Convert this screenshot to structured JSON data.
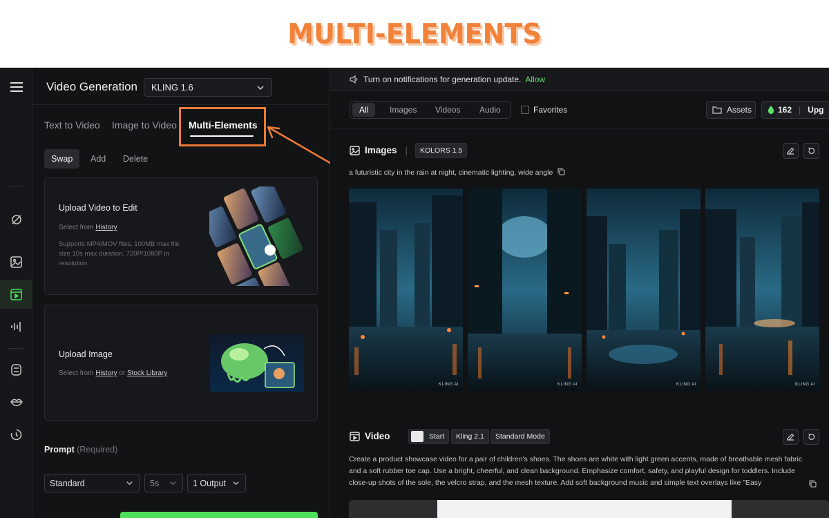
{
  "banner": {
    "title": "MULTI-ELEMENTS"
  },
  "rail": {
    "icons": [
      "menu-icon",
      "magic-brush-icon",
      "image-icon",
      "video-icon",
      "audio-icon",
      "avatar-frame-icon",
      "lips-icon",
      "history-icon"
    ]
  },
  "left": {
    "title": "Video Generation",
    "model": "KLING 1.6",
    "tabs": [
      "Text to Video",
      "Image to Video",
      "Multi-Elements"
    ],
    "actions": [
      "Swap",
      "Add",
      "Delete"
    ],
    "upload_video": {
      "title": "Upload Video to Edit",
      "select_prefix": "Select from ",
      "history_link": "History",
      "desc": "Supports MP4/MOV files, 100MB max file size 10s max duration, 720P/1080P in resolution"
    },
    "upload_image": {
      "title": "Upload Image",
      "select_prefix": "Select from ",
      "history_link": "History",
      "or": " or ",
      "stock_link": "Stock Library"
    },
    "prompt_label": "Prompt",
    "prompt_required": "(Required)",
    "mode_select": "Standard",
    "duration_select": "5s",
    "output_select": "1 Output"
  },
  "right": {
    "notification": "Turn on notifications for generation update.",
    "allow": "Allow",
    "filters": [
      "All",
      "Images",
      "Videos",
      "Audio"
    ],
    "favorites": "Favorites",
    "assets": "Assets",
    "credits": "162",
    "upgrade": "Upg",
    "images_section": {
      "title": "Images",
      "model_badge": "KOLORS 1.5",
      "prompt": "a futuristic city in the rain at night, cinematic lighting, wide angle",
      "watermark": "KLING AI"
    },
    "video_section": {
      "title": "Video",
      "start_badge": "Start",
      "model_badge": "Kling 2.1",
      "mode_badge": "Standard Mode",
      "description": "Create a product showcase video for a pair of children's shoes. The shoes are white with light green accents, made of breathable mesh fabric and a soft rubber toe cap. Use a bright, cheerful, and clean background. Emphasize comfort, safety, and playful design for toddlers. Include close-up shots of the sole, the velcro strap, and the mesh texture. Add soft background music and simple text overlays like \"Easy"
    }
  },
  "colors": {
    "accent_orange": "#ee7b36",
    "accent_green": "#5ee06a",
    "background": "#111214"
  }
}
